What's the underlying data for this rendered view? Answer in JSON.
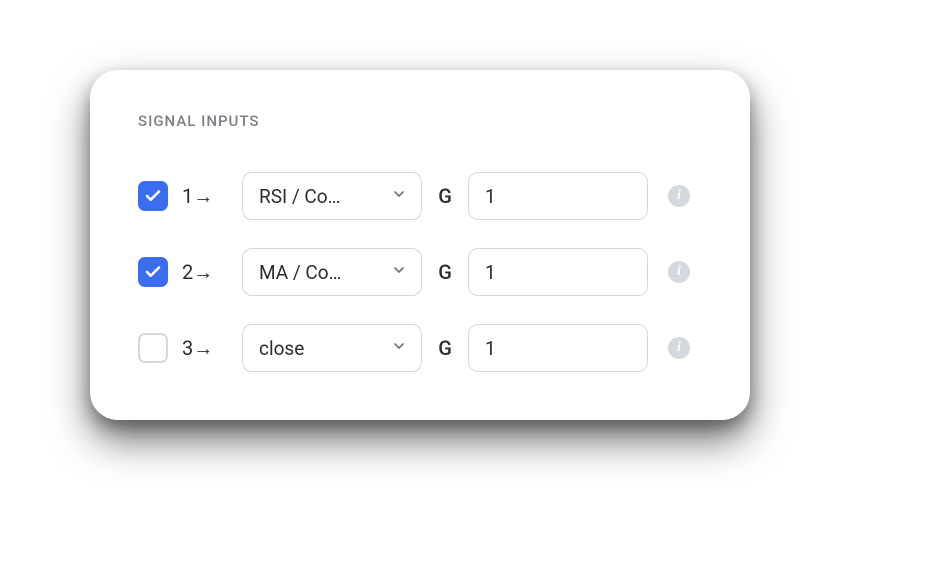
{
  "section_title": "SIGNAL INPUTS",
  "g_label": "G",
  "info_glyph": "i",
  "rows": [
    {
      "checked": true,
      "index_label": "1→",
      "select_value": "RSI / Co…",
      "input_value": "1"
    },
    {
      "checked": true,
      "index_label": "2→",
      "select_value": "MA / Co…",
      "input_value": "1"
    },
    {
      "checked": false,
      "index_label": "3→",
      "select_value": "close",
      "input_value": "1"
    }
  ]
}
